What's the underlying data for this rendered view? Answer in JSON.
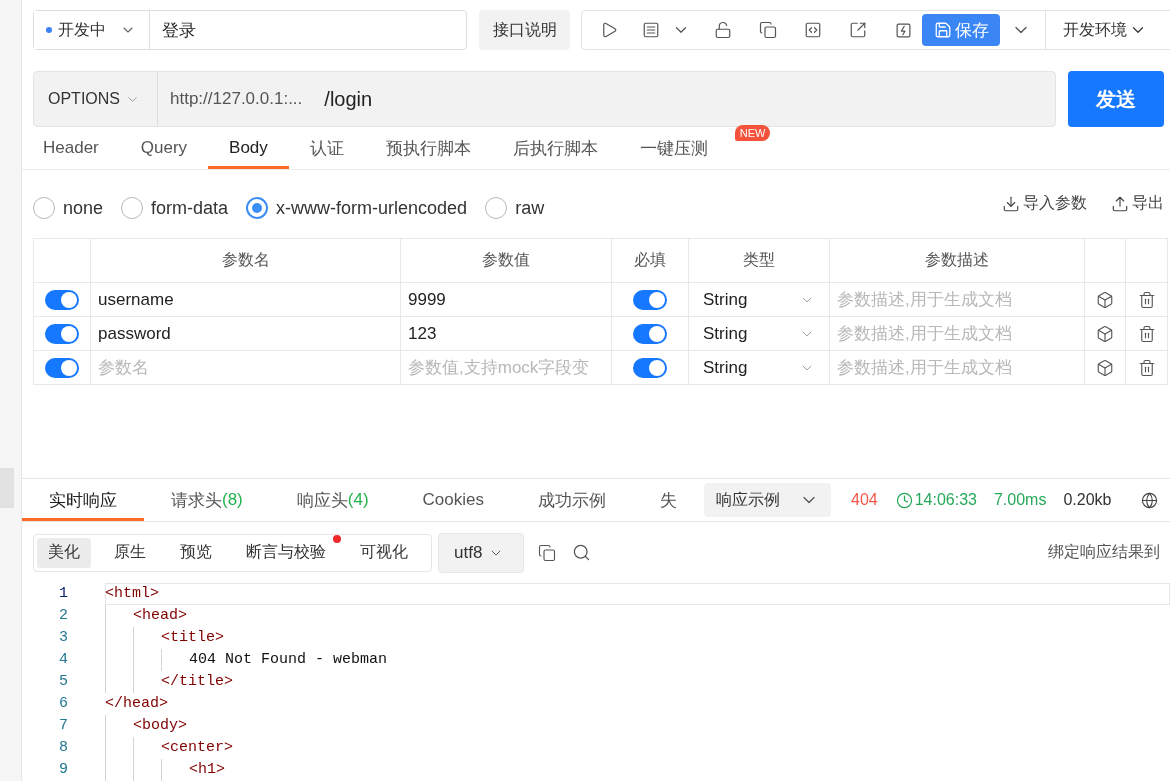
{
  "top_bar": {
    "status": "开发中",
    "title": "登录",
    "doc_button": "接口说明",
    "save_button": "保存",
    "environment": "开发环境"
  },
  "request": {
    "method": "OPTIONS",
    "host": "http://127.0.0.1:...",
    "path": "/login",
    "send_button": "发送"
  },
  "request_tabs": [
    {
      "label": "Header",
      "selected": false
    },
    {
      "label": "Query",
      "selected": false
    },
    {
      "label": "Body",
      "selected": true
    },
    {
      "label": "认证",
      "selected": false
    },
    {
      "label": "预执行脚本",
      "selected": false
    },
    {
      "label": "后执行脚本",
      "selected": false
    },
    {
      "label": "一键压测",
      "selected": false,
      "badge": "NEW"
    }
  ],
  "body_types": [
    {
      "label": "none",
      "selected": false
    },
    {
      "label": "form-data",
      "selected": false
    },
    {
      "label": "x-www-form-urlencoded",
      "selected": true
    },
    {
      "label": "raw",
      "selected": false
    }
  ],
  "param_actions": [
    {
      "kind": "import",
      "label": "导入参数"
    },
    {
      "kind": "export",
      "label": "导出"
    }
  ],
  "params_table": {
    "columns": [
      "参数名",
      "参数值",
      "必填",
      "类型",
      "参数描述"
    ],
    "rows": [
      {
        "enabled": true,
        "name": "username",
        "value": "9999",
        "required": true,
        "type": "String",
        "description_placeholder": "参数描述,用于生成文档"
      },
      {
        "enabled": true,
        "name": "password",
        "value": "123",
        "required": true,
        "type": "String",
        "description_placeholder": "参数描述,用于生成文档"
      },
      {
        "enabled": true,
        "name_placeholder": "参数名",
        "value_placeholder": "参数值,支持mock字段变",
        "required": true,
        "type": "String",
        "description_placeholder": "参数描述,用于生成文档"
      }
    ]
  },
  "response": {
    "tabs": [
      {
        "label": "实时响应",
        "selected": true
      },
      {
        "label": "请求头",
        "count": "(8)",
        "selected": false
      },
      {
        "label": "响应头",
        "count": "(4)",
        "selected": false
      },
      {
        "label": "Cookies",
        "selected": false
      },
      {
        "label": "成功示例",
        "selected": false
      },
      {
        "label": "失",
        "selected": false
      }
    ],
    "example_select": "响应示例",
    "status_code": "404",
    "time": "14:06:33",
    "duration": "7.00ms",
    "size": "0.20kb",
    "view_modes": [
      {
        "label": "美化",
        "selected": true,
        "has_notice": false
      },
      {
        "label": "原生",
        "selected": false,
        "has_notice": false
      },
      {
        "label": "预览",
        "selected": false,
        "has_notice": false
      },
      {
        "label": "断言与校验",
        "selected": false,
        "has_notice": true
      },
      {
        "label": "可视化",
        "selected": false,
        "has_notice": false
      }
    ],
    "encoding": "utf8",
    "bind_link": "绑定响应结果到",
    "code_lines": [
      {
        "number": "1",
        "kind": "tag",
        "text": "<html>",
        "current": true,
        "children": [
          {
            "number": "2",
            "kind": "tag",
            "text": "<head>",
            "current": false,
            "children": [
              {
                "number": "3",
                "kind": "tag",
                "text": "<title>",
                "current": false,
                "children": [
                  {
                    "number": "4",
                    "kind": "text",
                    "text": "404 Not Found - webman",
                    "current": false
                  }
                ]
              },
              {
                "number": "5",
                "kind": "tag",
                "text": "</title>",
                "current": false
              }
            ]
          }
        ]
      },
      {
        "number": "6",
        "kind": "tag",
        "text": "</head>",
        "current": false,
        "children": [
          {
            "number": "7",
            "kind": "tag",
            "text": "<body>",
            "current": false,
            "children": [
              {
                "number": "8",
                "kind": "tag",
                "text": "<center>",
                "current": false,
                "children": [
                  {
                    "number": "9",
                    "kind": "tag",
                    "text": "<h1>",
                    "current": false
                  }
                ]
              }
            ]
          }
        ]
      }
    ]
  }
}
